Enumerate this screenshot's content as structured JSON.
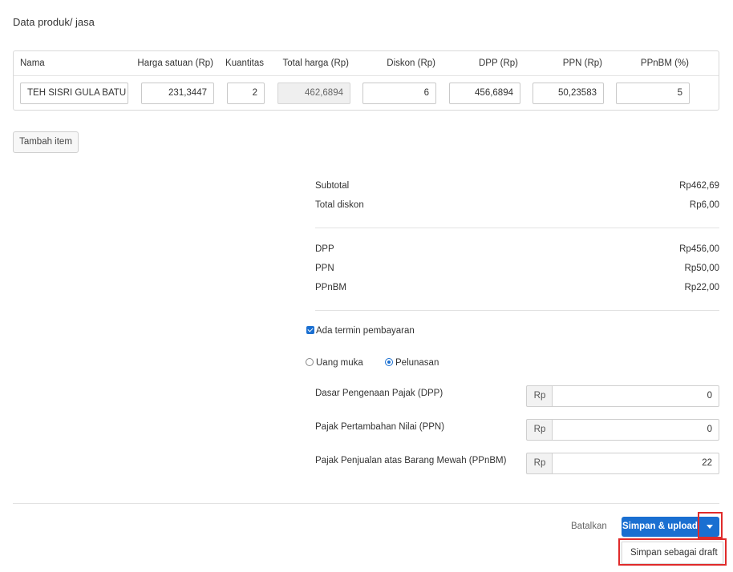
{
  "section_title": "Data produk/ jasa",
  "table": {
    "headers": {
      "nama": "Nama",
      "harga_satuan": "Harga satuan (Rp)",
      "kuantitas": "Kuantitas",
      "total_harga": "Total harga (Rp)",
      "diskon": "Diskon (Rp)",
      "dpp": "DPP (Rp)",
      "ppn": "PPN (Rp)",
      "ppnbm": "PPnBM (%)"
    },
    "row": {
      "nama": "TEH SISRI GULA BATU A",
      "harga_satuan": "231,3447",
      "kuantitas": "2",
      "total_harga": "462,6894",
      "diskon": "6",
      "dpp": "456,6894",
      "ppn": "50,23583",
      "ppnbm": "5"
    }
  },
  "add_item_label": "Tambah item",
  "summary": {
    "subtotal_label": "Subtotal",
    "subtotal_value": "Rp462,69",
    "total_diskon_label": "Total diskon",
    "total_diskon_value": "Rp6,00",
    "dpp_label": "DPP",
    "dpp_value": "Rp456,00",
    "ppn_label": "PPN",
    "ppn_value": "Rp50,00",
    "ppnbm_label": "PPnBM",
    "ppnbm_value": "Rp22,00"
  },
  "termin": {
    "checkbox_label": "Ada termin pembayaran",
    "checked": true,
    "radio_uang_muka": "Uang muka",
    "radio_pelunasan": "Pelunasan",
    "selected": "Pelunasan"
  },
  "fields": {
    "currency": "Rp",
    "dpp_label": "Dasar Pengenaan Pajak (DPP)",
    "dpp_value": "0",
    "ppn_label": "Pajak Pertambahan Nilai (PPN)",
    "ppn_value": "0",
    "ppnbm_label": "Pajak Penjualan atas Barang Mewah (PPnBM)",
    "ppnbm_value": "22"
  },
  "footer": {
    "cancel_label": "Batalkan",
    "primary_label": "Simpan & upload",
    "dropdown_item": "Simpan sebagai draft"
  },
  "colors": {
    "primary": "#1a6fd1",
    "highlight": "#e02b2b"
  }
}
